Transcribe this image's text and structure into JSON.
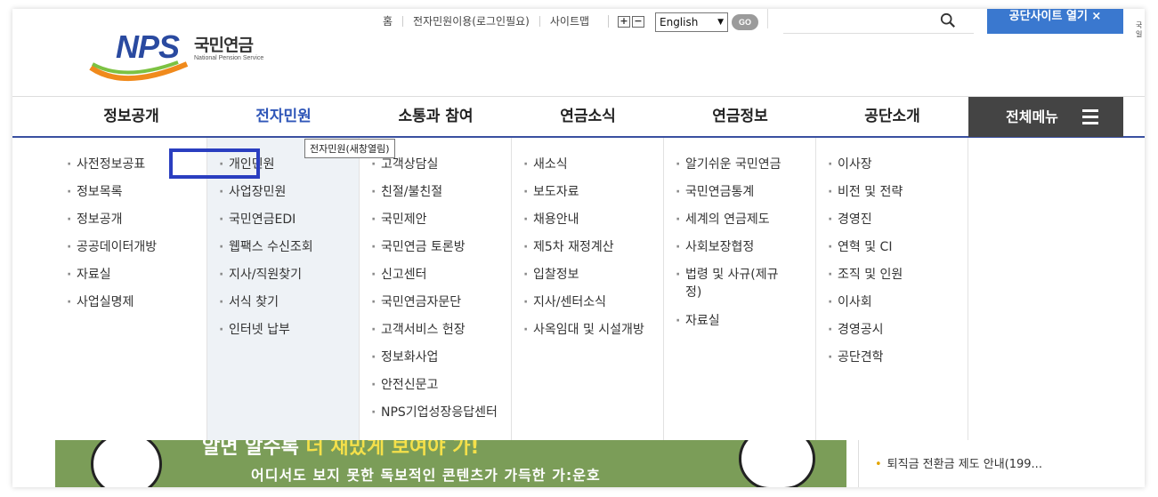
{
  "header": {
    "logo_text": "NPS",
    "logo_kor": "국민연금",
    "logo_eng": "National Pension Service",
    "util_links": [
      "홈",
      "전자민원이용(로그인필요)",
      "사이트맵"
    ],
    "zoom_in": "+",
    "zoom_out": "−",
    "language": "English",
    "go_label": "GO",
    "family_site": "공단사이트 열기  ×",
    "edge_text": "국 일"
  },
  "nav": {
    "items": [
      "정보공개",
      "전자민원",
      "소통과 참여",
      "연금소식",
      "연금정보",
      "공단소개"
    ],
    "active_index": 1,
    "all_menu": "전체메뉴"
  },
  "tooltip": "전자민원(새창열림)",
  "mega": {
    "col1": [
      "사전정보공표",
      "정보목록",
      "정보공개",
      "공공데이터개방",
      "자료실",
      "사업실명제"
    ],
    "col2": [
      "개인민원",
      "사업장민원",
      "국민연금EDI",
      "웹팩스 수신조회",
      "지사/직원찾기",
      "서식 찾기",
      "인터넷 납부"
    ],
    "col3": [
      "고객상담실",
      "친절/불친절",
      "국민제안",
      "국민연금 토론방",
      "신고센터",
      "국민연금자문단",
      "고객서비스 헌장",
      "정보화사업",
      "안전신문고",
      "NPS기업성장응답센터"
    ],
    "col4": [
      "새소식",
      "보도자료",
      "채용안내",
      "제5차 재정계산",
      "입찰정보",
      "지사/센터소식",
      "사옥임대 및 시설개방"
    ],
    "col5": [
      "알기쉬운 국민연금",
      "국민연금통계",
      "세계의 연금제도",
      "사회보장협정",
      "법령 및 사규(제규정)",
      "자료실"
    ],
    "col6": [
      "이사장",
      "비전 및 전략",
      "경영진",
      "연혁 및 CI",
      "조직 및 인원",
      "이사회",
      "경영공시",
      "공단견학"
    ]
  },
  "banner": {
    "top_text_white": "알면 알수록 ",
    "top_text_yellow": "더 재밌게 보여야 가!",
    "bottom_text": "어디서도 보지 못한 독보적인 콘텐츠가 가득한 가:운호"
  },
  "side": {
    "item": "퇴직금 전환금 제도 안내(199..."
  },
  "colors": {
    "accent": "#2f56b8",
    "nav_all_bg": "#444444",
    "family_btn": "#3a78cf",
    "highlight_col": "#eef2f6",
    "banner_bg": "#7b9d58"
  }
}
